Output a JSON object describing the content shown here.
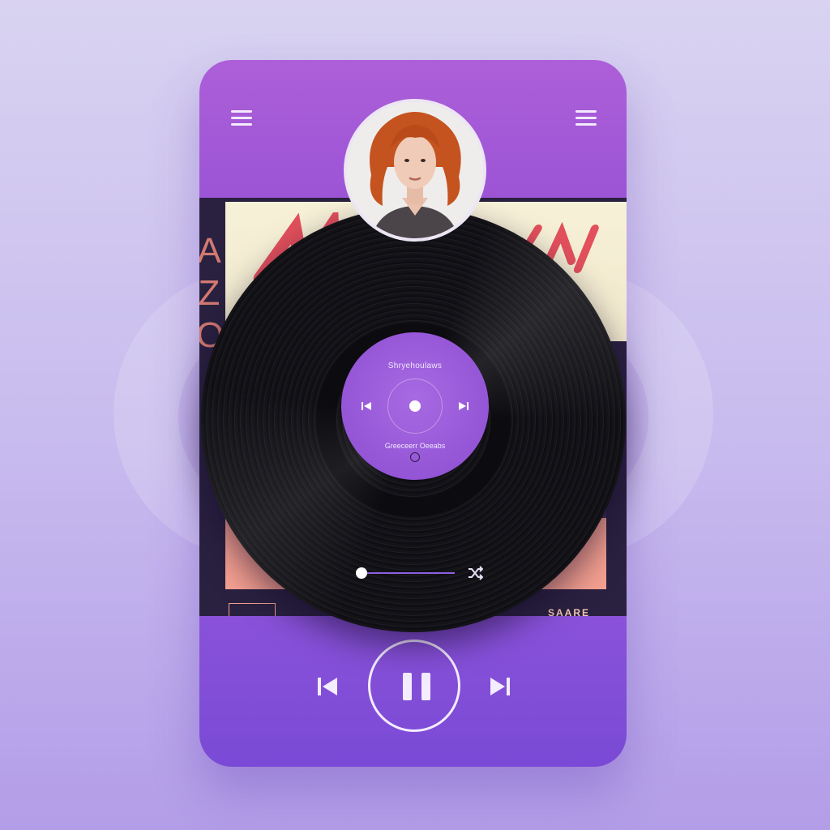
{
  "header": {
    "left_icon": "menu-icon",
    "right_icon": "menu-icon"
  },
  "artist": {
    "avatar": "woman with curly red hair"
  },
  "album_art": {
    "side_letters": "A\nZ\nO",
    "bottom_text": "SAARE"
  },
  "record_label": {
    "title": "Shryehoulaws",
    "subtitle": "Greeceerr Oeeabs"
  },
  "playback": {
    "progress": 0.0,
    "is_playing": true
  },
  "controls": {
    "prev_icon": "skip-previous-icon",
    "pause_icon": "pause-icon",
    "next_icon": "skip-next-icon",
    "shuffle_icon": "shuffle-icon"
  },
  "colors": {
    "card_top": "#ad5fd8",
    "card_bottom": "#7a4ad6",
    "label": "#9455d6",
    "accent": "#8f5fe0"
  }
}
